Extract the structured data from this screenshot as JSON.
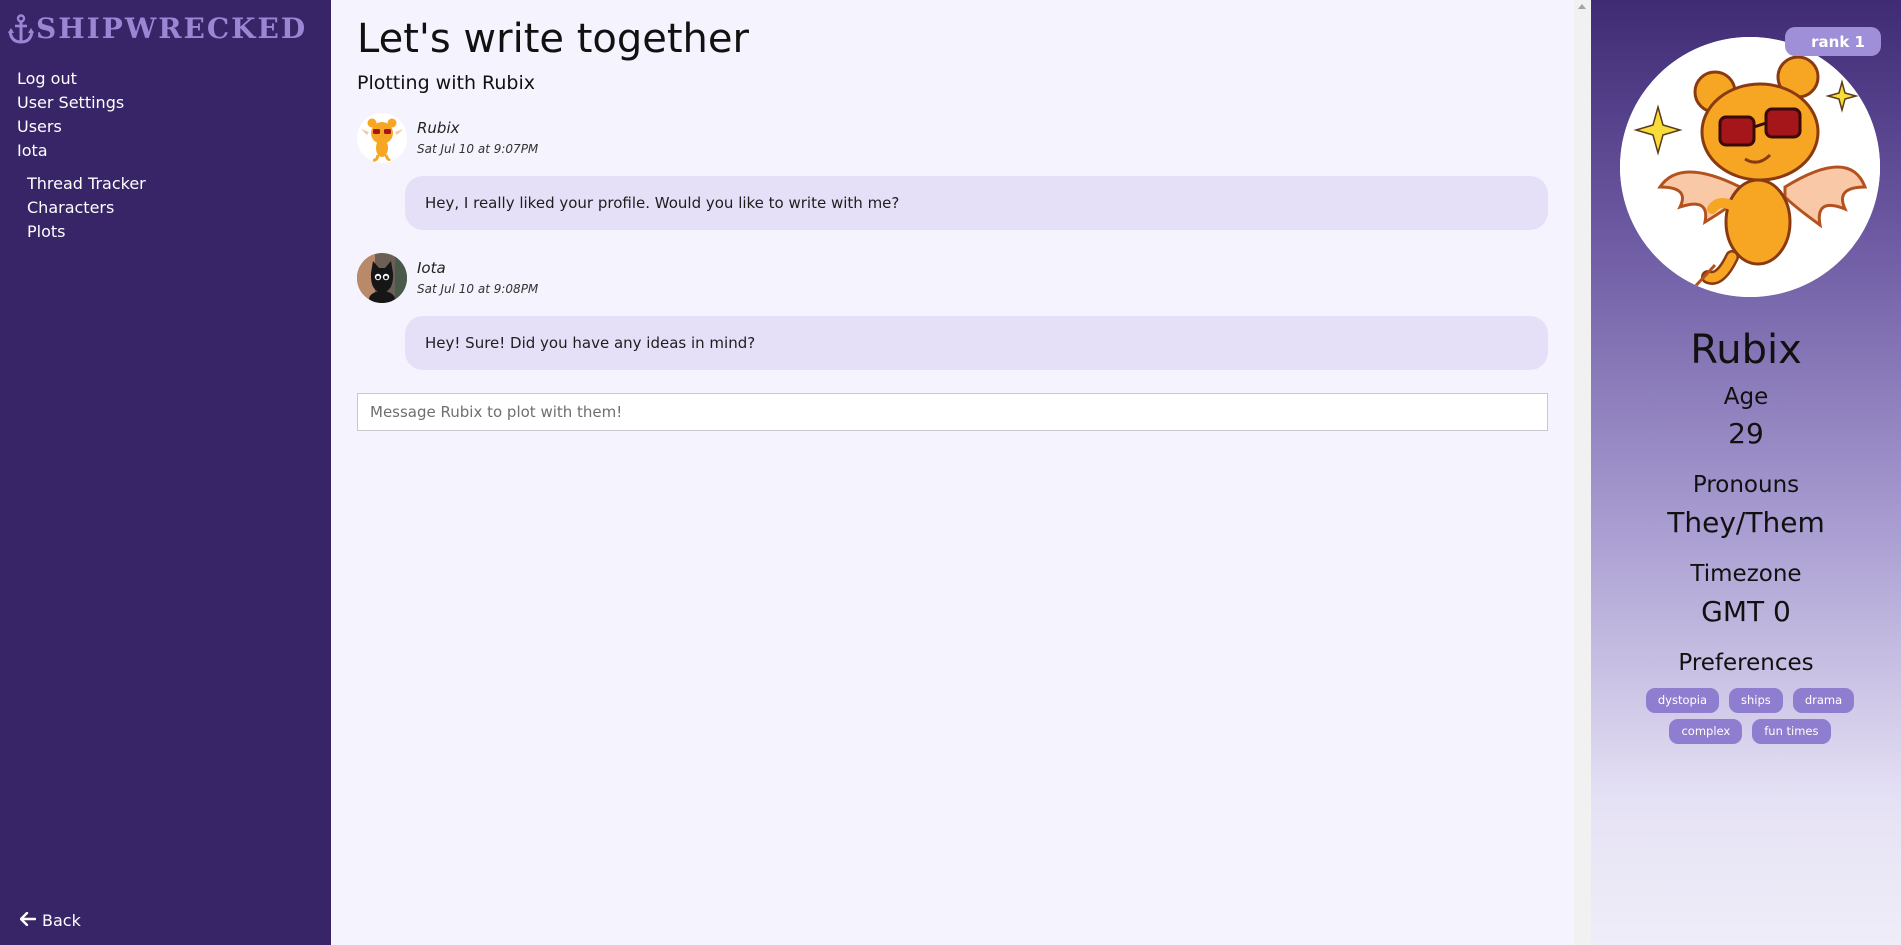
{
  "app": {
    "logo_text": "SHIPWRECKED"
  },
  "sidebar": {
    "nav": [
      {
        "label": "Log out"
      },
      {
        "label": "User Settings"
      },
      {
        "label": "Users"
      },
      {
        "label": "Iota"
      }
    ],
    "subnav": [
      {
        "label": "Thread Tracker"
      },
      {
        "label": "Characters"
      },
      {
        "label": "Plots"
      }
    ],
    "back_label": "Back"
  },
  "main": {
    "title": "Let's write together",
    "subtitle": "Plotting with Rubix",
    "messages": [
      {
        "author": "Rubix",
        "timestamp": "Sat Jul 10 at 9:07PM",
        "text": "Hey, I really liked your profile. Would you like to write with me?"
      },
      {
        "author": "Iota",
        "timestamp": "Sat Jul 10 at 9:08PM",
        "text": "Hey! Sure! Did you have any ideas in mind?"
      }
    ],
    "compose_placeholder": "Message Rubix to plot with them!"
  },
  "profile": {
    "rank": "rank 1",
    "name": "Rubix",
    "age_label": "Age",
    "age_value": "29",
    "pronouns_label": "Pronouns",
    "pronouns_value": "They/Them",
    "timezone_label": "Timezone",
    "timezone_value": "GMT 0",
    "preferences_label": "Preferences",
    "tags": [
      "dystopia",
      "ships",
      "drama",
      "complex",
      "fun times"
    ]
  },
  "colors": {
    "sidebar_bg": "#372567",
    "logo": "#9b86d4",
    "main_bg": "#f5f3fd",
    "bubble_bg": "#e5e0f7",
    "tag_bg": "#8f7ed0",
    "rank_bg": "#9f8fd8"
  },
  "icons": {
    "logo": "anchor-icon",
    "back": "arrow-left-icon"
  }
}
